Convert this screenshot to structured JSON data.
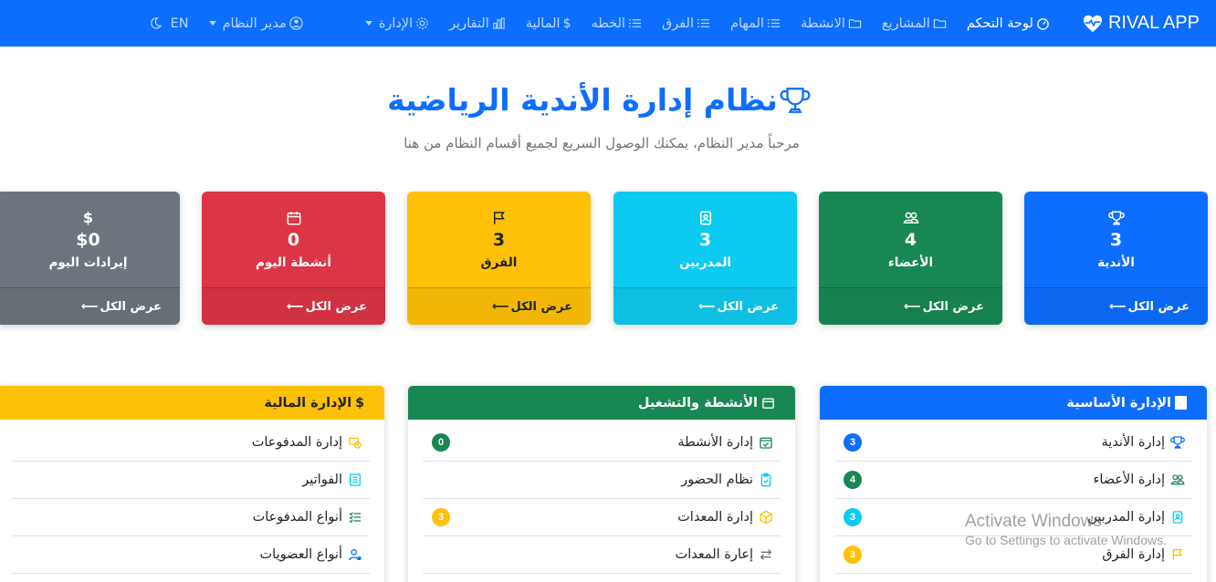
{
  "navbar": {
    "brand": "RIVAL APP",
    "items": [
      {
        "label": "لوحة التحكم",
        "icon": "speedometer-icon",
        "active": true
      },
      {
        "label": "المشاريع",
        "icon": "folder-icon"
      },
      {
        "label": "الانشطة",
        "icon": "folder-icon"
      },
      {
        "label": "المهام",
        "icon": "list-icon"
      },
      {
        "label": "الفرق",
        "icon": "list-icon"
      },
      {
        "label": "الخطه",
        "icon": "list-icon"
      },
      {
        "label": "المالية",
        "icon": "dollar-icon"
      },
      {
        "label": "التقارير",
        "icon": "bar-chart-icon"
      },
      {
        "label": "الإدارة",
        "icon": "gear-icon"
      }
    ],
    "user": "مدير النظام",
    "lang": "EN"
  },
  "hero": {
    "title": "نظام إدارة الأندية الرياضية",
    "subtitle": "مرحباً مدير النظام، يمكنك الوصول السريع لجميع أقسام النظام من هنا"
  },
  "stats": [
    {
      "value": "3",
      "label": "الأندية",
      "link": "عرض الكل",
      "color": "#0d6efd",
      "icon": "trophy-icon"
    },
    {
      "value": "4",
      "label": "الأعضاء",
      "link": "عرض الكل",
      "color": "#198754",
      "icon": "people-icon"
    },
    {
      "value": "3",
      "label": "المدربين",
      "link": "عرض الكل",
      "color": "#0dcaf0",
      "icon": "badge-icon"
    },
    {
      "value": "3",
      "label": "الفرق",
      "link": "عرض الكل",
      "color": "#ffc107",
      "icon": "flag-icon"
    },
    {
      "value": "0",
      "label": "أنشطة اليوم",
      "link": "عرض الكل",
      "color": "#dc3545",
      "icon": "calendar-icon"
    },
    {
      "value": "$0",
      "label": "إيرادات اليوم",
      "link": "عرض الكل",
      "color": "#6c757d",
      "icon": "dollar-icon"
    }
  ],
  "panels": [
    {
      "title": "الإدارة الأساسية",
      "color": "#0d6efd",
      "rows": [
        {
          "label": "إدارة الأندية",
          "badge": "3",
          "badge_color": "#0d6efd",
          "icon_color": "#0d6efd"
        },
        {
          "label": "إدارة الأعضاء",
          "badge": "4",
          "badge_color": "#198754",
          "icon_color": "#198754"
        },
        {
          "label": "إدارة المدربين",
          "badge": "3",
          "badge_color": "#0dcaf0",
          "icon_color": "#0dcaf0"
        },
        {
          "label": "إدارة الفرق",
          "badge": "3",
          "badge_color": "#ffc107",
          "icon_color": "#ffc107"
        }
      ]
    },
    {
      "title": "الأنشطة والتشغيل",
      "color": "#198754",
      "rows": [
        {
          "label": "إدارة الأنشطة",
          "badge": "0",
          "badge_color": "#198754",
          "icon_color": "#198754"
        },
        {
          "label": "نظام الحضور",
          "icon_color": "#0dcaf0"
        },
        {
          "label": "إدارة المعدات",
          "badge": "3",
          "badge_color": "#ffc107",
          "icon_color": "#ffc107"
        },
        {
          "label": "إعارة المعدات",
          "icon_color": "#6c757d"
        }
      ]
    },
    {
      "title": "الإدارة المالية",
      "color": "#ffc107",
      "rows": [
        {
          "label": "إدارة المدفوعات",
          "icon_color": "#ffc107"
        },
        {
          "label": "الفواتير",
          "icon_color": "#0dcaf0"
        },
        {
          "label": "أنواع المدفوعات",
          "icon_color": "#198754"
        },
        {
          "label": "أنواع العضويات",
          "icon_color": "#0d6efd"
        }
      ]
    }
  ],
  "watermark": {
    "line1": "Activate Windows",
    "line2": "Go to Settings to activate Windows."
  }
}
